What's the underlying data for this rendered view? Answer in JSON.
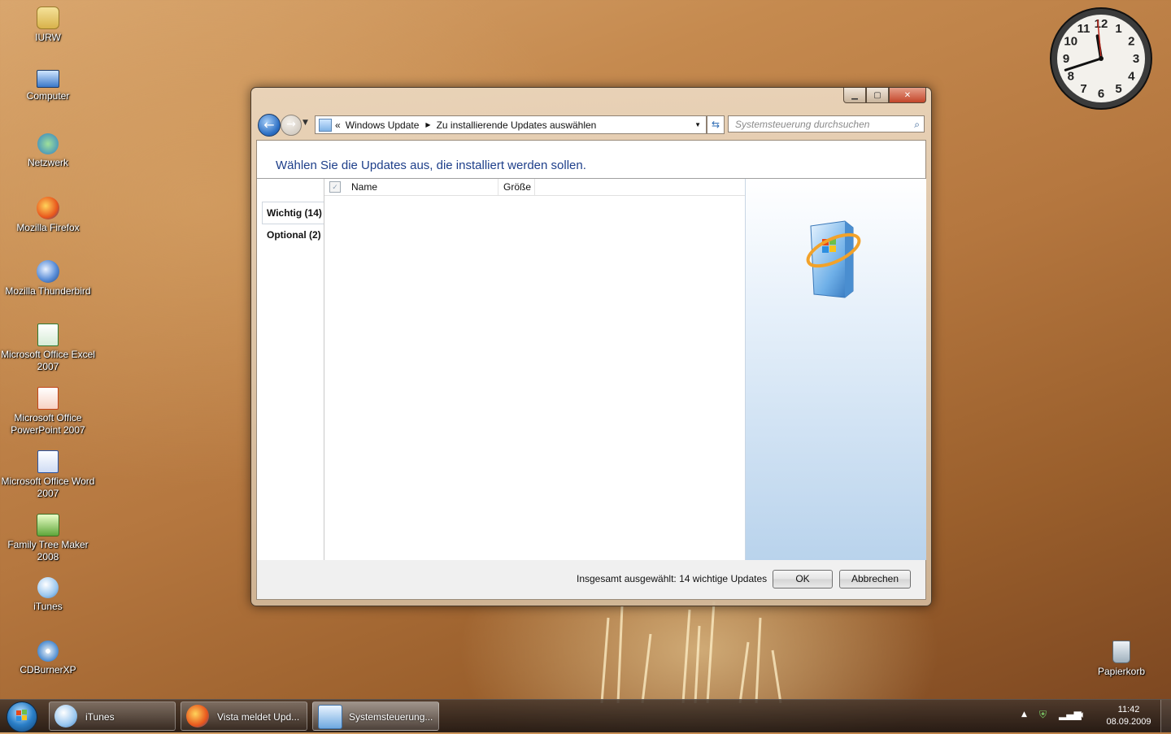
{
  "desktop": {
    "icons": [
      {
        "label": "IURW"
      },
      {
        "label": "Computer"
      },
      {
        "label": "Netzwerk"
      },
      {
        "label": "Mozilla Firefox"
      },
      {
        "label": "Mozilla Thunderbird"
      },
      {
        "label": "Microsoft Office Excel 2007"
      },
      {
        "label": "Microsoft Office PowerPoint 2007"
      },
      {
        "label": "Microsoft Office Word 2007"
      },
      {
        "label": "Family Tree Maker 2008"
      },
      {
        "label": "iTunes"
      },
      {
        "label": "CDBurnerXP"
      }
    ],
    "recycle_bin": "Papierkorb"
  },
  "clock": {
    "numerals": [
      "12",
      "1",
      "2",
      "3",
      "4",
      "5",
      "6",
      "7",
      "8",
      "9",
      "10",
      "11"
    ],
    "hour": 11,
    "minute": 42
  },
  "window": {
    "address": {
      "prefix": "«",
      "segments": [
        "Windows Update",
        "Zu installierende Updates auswählen"
      ]
    },
    "search_placeholder": "Systemsteuerung durchsuchen",
    "heading": "Wählen Sie die Updates aus, die installiert werden sollen.",
    "tabs": [
      {
        "label": "Wichtig (14)"
      },
      {
        "label": "Optional (2)"
      }
    ],
    "columns": {
      "name": "Name",
      "size": "Größe"
    },
    "summary": "Insgesamt ausgewählt: 14 wichtige Updates",
    "ok_label": "OK",
    "cancel_label": "Abbrechen"
  },
  "taskbar": {
    "buttons": [
      {
        "label": "iTunes",
        "icon": "itunes-icon"
      },
      {
        "label": "Vista meldet Upd...",
        "icon": "firefox-icon"
      },
      {
        "label": "Systemsteuerung...",
        "icon": "control-panel-icon"
      }
    ],
    "time": "11:42",
    "date": "08.09.2009"
  },
  "colors": {
    "accent": "#1e3f8a",
    "close_button": "#c3452a"
  }
}
